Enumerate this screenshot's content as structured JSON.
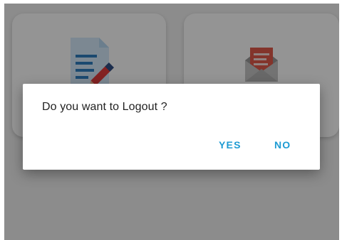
{
  "background": {
    "cards": [
      {
        "icon": "document-edit-icon"
      },
      {
        "icon": "open-envelope-icon"
      }
    ]
  },
  "dialog": {
    "message": "Do you want to Logout ?",
    "yes_label": "YES",
    "no_label": "NO"
  },
  "colors": {
    "accent": "#1e9bd3",
    "scrim": "rgba(0,0,0,0.42)",
    "dialog_bg": "#ffffff"
  }
}
